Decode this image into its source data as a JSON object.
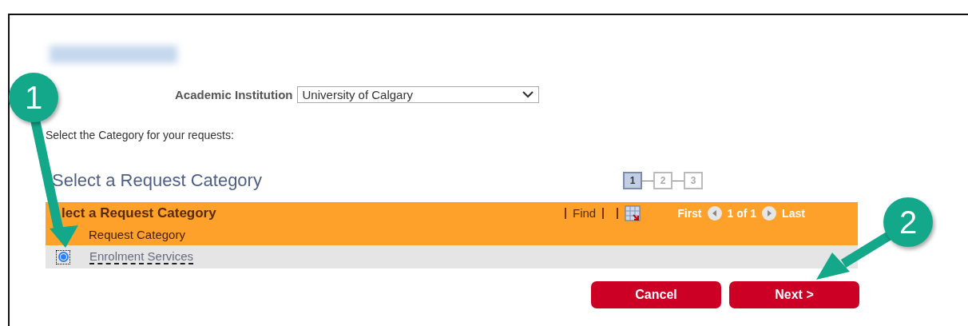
{
  "institution": {
    "label": "Academic Institution",
    "value": "University of Calgary"
  },
  "instruction": "Select the Category for your requests:",
  "heading": "Select a Request Category",
  "steps": [
    {
      "label": "1",
      "selected": true
    },
    {
      "label": "2",
      "selected": false
    },
    {
      "label": "3",
      "selected": false
    }
  ],
  "grid": {
    "title": "lect a Request Category",
    "find": "Find",
    "first": "First",
    "page": "1 of 1",
    "last": "Last",
    "columns": [
      "Request Category"
    ],
    "rows": [
      {
        "category": "Enrolment Services",
        "selected": true
      }
    ]
  },
  "buttons": [
    {
      "label": "Cancel"
    },
    {
      "label": "Next >"
    }
  ],
  "callouts": [
    {
      "label": "1"
    },
    {
      "label": "2"
    }
  ]
}
